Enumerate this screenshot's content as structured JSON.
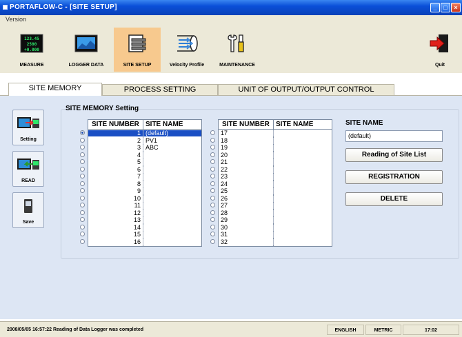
{
  "window": {
    "title": "PORTAFLOW-C - [SITE SETUP]"
  },
  "menu": {
    "version": "Version"
  },
  "toolbar": [
    {
      "label": "MEASURE",
      "icon": "measure-display-icon",
      "display_lines": [
        "123.45",
        "2500",
        "+0.000"
      ]
    },
    {
      "label": "LOGGER DATA",
      "icon": "logger-data-icon"
    },
    {
      "label": "SITE SETUP",
      "icon": "site-setup-icon",
      "active": true
    },
    {
      "label": "Velocity Profile",
      "icon": "velocity-profile-icon"
    },
    {
      "label": "MAINTENANCE",
      "icon": "maintenance-tools-icon"
    },
    {
      "label": "Quit",
      "icon": "quit-door-icon"
    }
  ],
  "tabs": [
    {
      "label": "SITE MEMORY",
      "active": true
    },
    {
      "label": "PROCESS SETTING"
    },
    {
      "label": "UNIT OF OUTPUT/OUTPUT CONTROL"
    }
  ],
  "side_buttons": [
    {
      "label": "Setting",
      "icon": "setting-transfer-icon"
    },
    {
      "label": "READ",
      "icon": "read-transfer-icon"
    },
    {
      "label": "Save",
      "icon": "save-device-icon"
    }
  ],
  "site_memory": {
    "title": "SITE MEMORY Setting",
    "headers": {
      "number": "SITE NUMBER",
      "name": "SITE NAME"
    },
    "left_rows": [
      {
        "n": "1",
        "name": "(default)",
        "selected": true
      },
      {
        "n": "2",
        "name": "PV1"
      },
      {
        "n": "3",
        "name": "ABC"
      },
      {
        "n": "4",
        "name": ""
      },
      {
        "n": "5",
        "name": ""
      },
      {
        "n": "6",
        "name": ""
      },
      {
        "n": "7",
        "name": ""
      },
      {
        "n": "8",
        "name": ""
      },
      {
        "n": "9",
        "name": ""
      },
      {
        "n": "10",
        "name": ""
      },
      {
        "n": "11",
        "name": ""
      },
      {
        "n": "12",
        "name": ""
      },
      {
        "n": "13",
        "name": ""
      },
      {
        "n": "14",
        "name": ""
      },
      {
        "n": "15",
        "name": ""
      },
      {
        "n": "16",
        "name": ""
      }
    ],
    "right_rows": [
      {
        "n": "17",
        "name": ""
      },
      {
        "n": "18",
        "name": ""
      },
      {
        "n": "19",
        "name": ""
      },
      {
        "n": "20",
        "name": ""
      },
      {
        "n": "21",
        "name": ""
      },
      {
        "n": "22",
        "name": ""
      },
      {
        "n": "23",
        "name": ""
      },
      {
        "n": "24",
        "name": ""
      },
      {
        "n": "25",
        "name": ""
      },
      {
        "n": "26",
        "name": ""
      },
      {
        "n": "27",
        "name": ""
      },
      {
        "n": "28",
        "name": ""
      },
      {
        "n": "29",
        "name": ""
      },
      {
        "n": "30",
        "name": ""
      },
      {
        "n": "31",
        "name": ""
      },
      {
        "n": "32",
        "name": ""
      }
    ]
  },
  "site_name_panel": {
    "label": "SITE NAME",
    "value": "(default)",
    "buttons": [
      "Reading of Site List",
      "REGISTRATION",
      "DELETE"
    ]
  },
  "statusbar": {
    "message": "2008/05/05 16:57:22 Reading of Data Logger was completed",
    "language": "ENGLISH",
    "units": "METRIC",
    "time": "17:02"
  },
  "colors": {
    "titlebar": "#0a4fd8",
    "active_tool": "#f7c98e",
    "selection": "#1a4fc4",
    "panel": "#dde6f4"
  }
}
